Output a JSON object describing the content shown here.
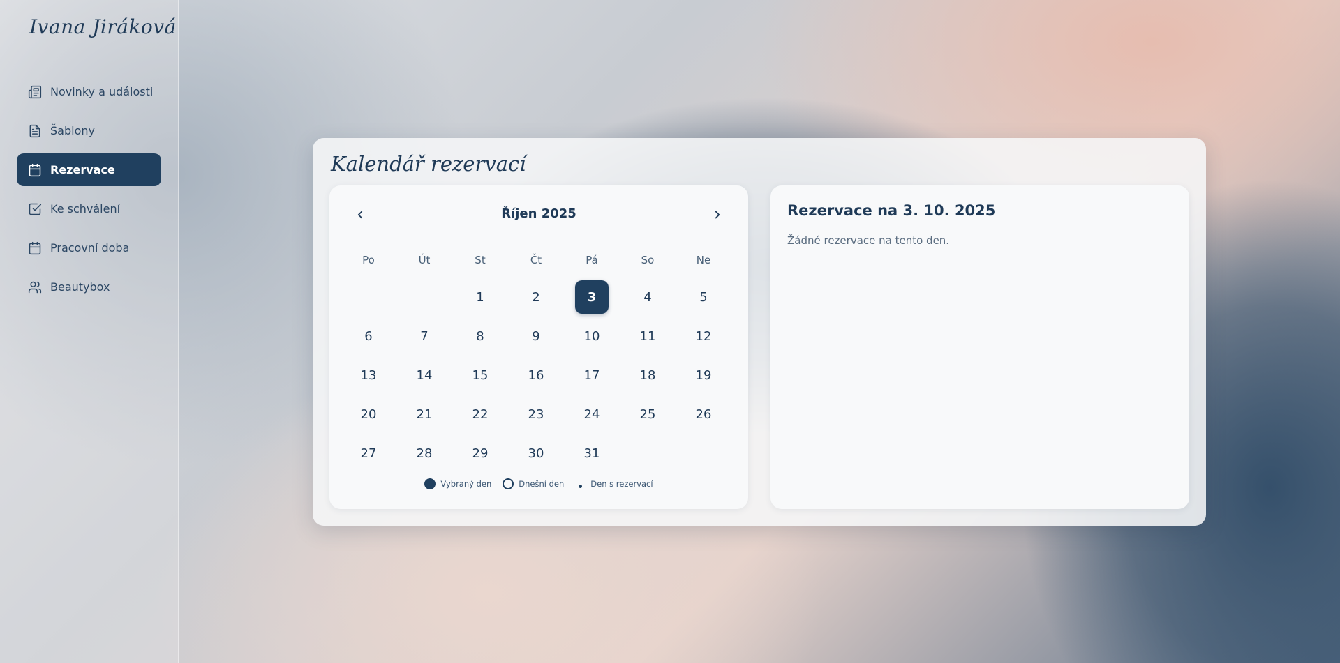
{
  "sidebar": {
    "brand": "Ivana Jiráková",
    "items": [
      {
        "label": "Novinky a události",
        "icon": "newspaper-icon"
      },
      {
        "label": "Šablony",
        "icon": "file-text-icon"
      },
      {
        "label": "Rezervace",
        "icon": "calendar-icon",
        "active": true
      },
      {
        "label": "Ke schválení",
        "icon": "check-square-icon"
      },
      {
        "label": "Pracovní doba",
        "icon": "calendar-icon"
      },
      {
        "label": "Beautybox",
        "icon": "users-icon"
      }
    ]
  },
  "panel": {
    "title": "Kalendář rezervací",
    "calendar": {
      "month_label": "Říjen 2025",
      "weekdays": [
        "Po",
        "Út",
        "St",
        "Čt",
        "Pá",
        "So",
        "Ne"
      ],
      "leading_blank_days": 2,
      "days": [
        "1",
        "2",
        "3",
        "4",
        "5",
        "6",
        "7",
        "8",
        "9",
        "10",
        "11",
        "12",
        "13",
        "14",
        "15",
        "16",
        "17",
        "18",
        "19",
        "20",
        "21",
        "22",
        "23",
        "24",
        "25",
        "26",
        "27",
        "28",
        "29",
        "30",
        "31"
      ],
      "selected_day": "3",
      "legend": {
        "selected": "Vybraný den",
        "today": "Dnešní den",
        "has_reservation": "Den s rezervací"
      }
    },
    "reservations": {
      "title": "Rezervace na 3. 10. 2025",
      "empty_message": "Žádné rezervace na tento den."
    }
  },
  "colors": {
    "accent": "#20405f",
    "text": "#1f3a57"
  }
}
